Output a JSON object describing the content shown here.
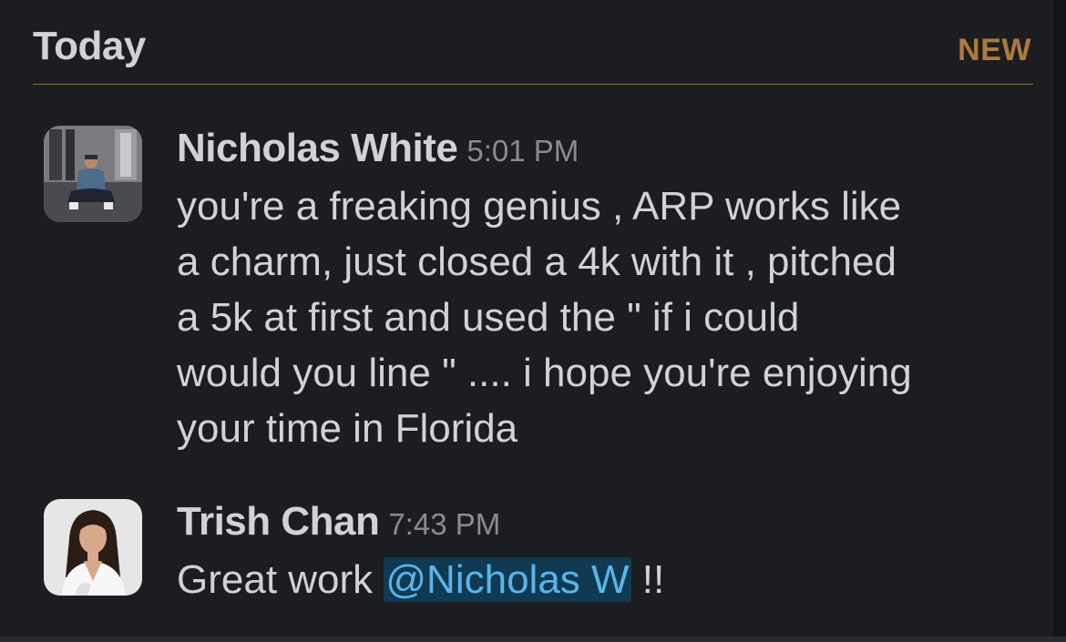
{
  "divider": {
    "label": "Today",
    "badge": "NEW"
  },
  "messages": [
    {
      "author": "Nicholas White",
      "time": "5:01 PM",
      "lines": [
        "you're a freaking genius , ARP works like",
        "a charm, just closed a 4k with it , pitched",
        "a 5k at first and used the \" if i could",
        "would you line \" .... i hope you're enjoying",
        "your time in Florida"
      ]
    },
    {
      "author": "Trish Chan",
      "time": "7:43 PM",
      "text_before": "Great work ",
      "mention": "@Nicholas W",
      "text_after": " !!"
    }
  ],
  "colors": {
    "background": "#1b1d21",
    "text": "#d1d2d3",
    "timestamp": "#8b8c8f",
    "new_badge": "#b07a3c",
    "divider_line": "#8a6a34",
    "mention_bg": "#0f3a52",
    "mention_text": "#5cb3e6"
  }
}
